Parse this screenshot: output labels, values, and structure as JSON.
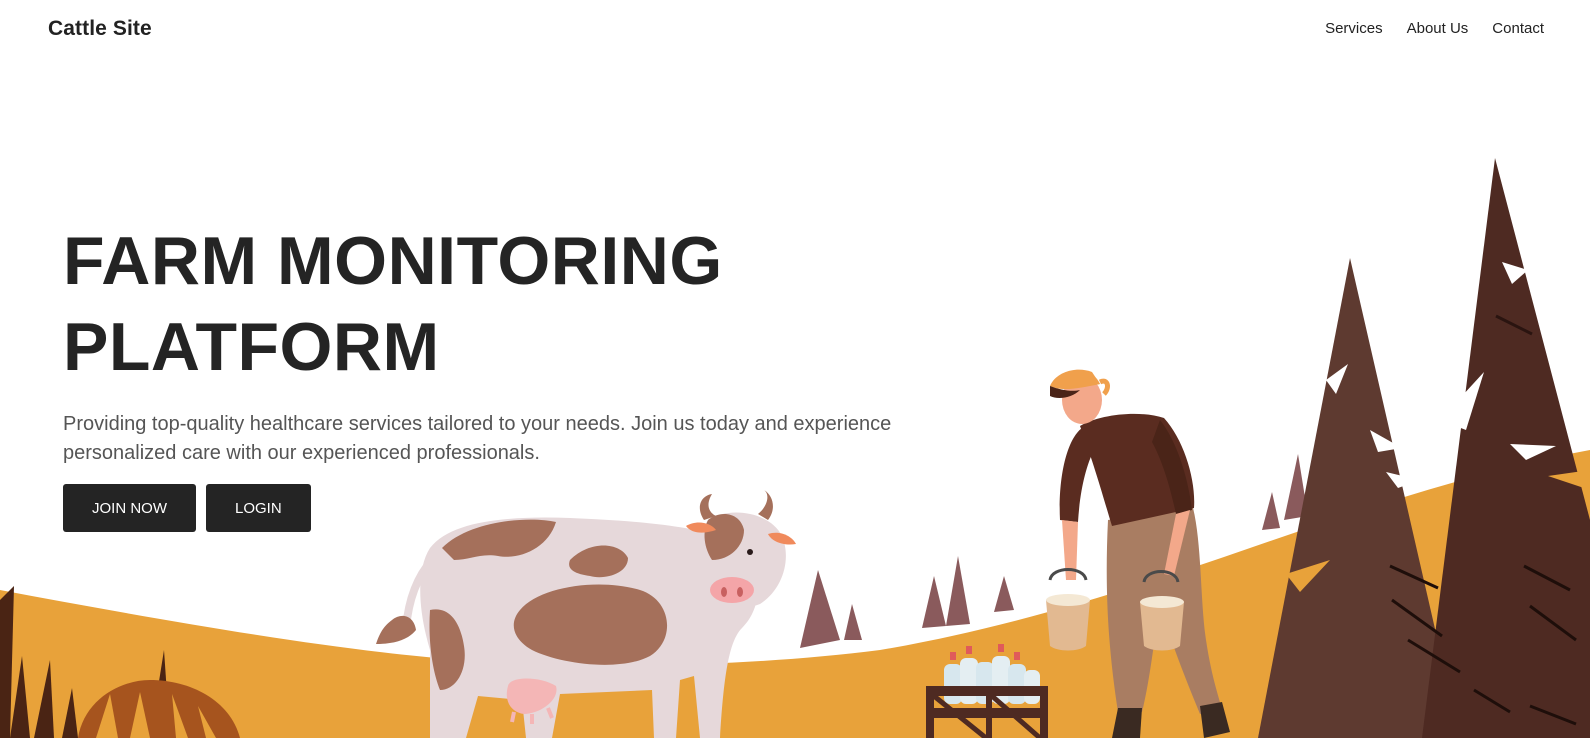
{
  "nav": {
    "brand": "Cattle Site",
    "links": [
      {
        "label": "Services"
      },
      {
        "label": "About Us"
      },
      {
        "label": "Contact"
      }
    ]
  },
  "hero": {
    "title_line1": "FARM MONITORING",
    "title_line2": "PLATFORM",
    "description": "Providing top-quality healthcare services tailored to your needs. Join us today and experience personalized care with our experienced professionals.",
    "primary_button": "JOIN NOW",
    "secondary_button": "LOGIN"
  },
  "illustration": {
    "icons": [
      "cow-icon",
      "farmer-icon",
      "milk-bucket-icon",
      "milk-bottle-crate-icon",
      "pine-tree-icon",
      "hill-icon",
      "grass-icon"
    ],
    "colors": {
      "ground": "#E8A23A",
      "tree_dark": "#4E2A22",
      "tree_mid": "#5E3A30",
      "tree_small": "#8A5A5C",
      "cow_body": "#E6D8DA",
      "cow_spots": "#A5705B",
      "shirt": "#5A2C20",
      "pants": "#A97D62",
      "cap": "#F0A04C",
      "bucket": "#E2B991",
      "bottles": "#D7E7EE"
    }
  }
}
